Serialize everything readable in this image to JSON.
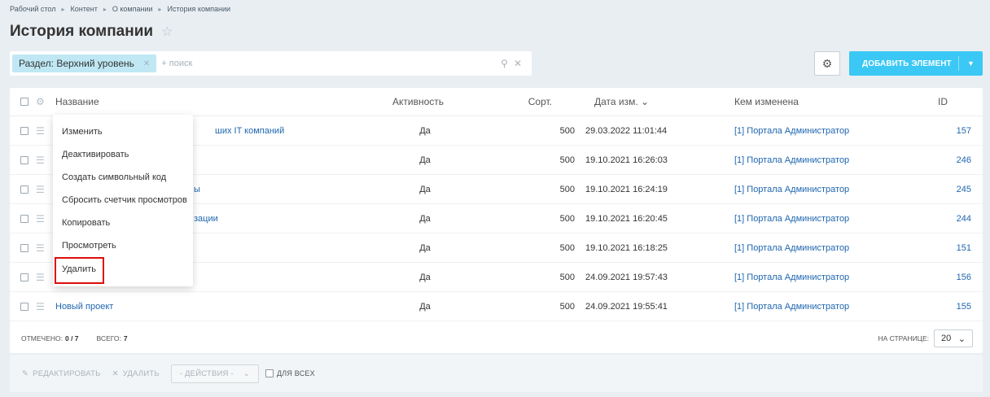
{
  "breadcrumb": [
    "Рабочий стол",
    "Контент",
    "О компании",
    "История компании"
  ],
  "page_title": "История компании",
  "filter": {
    "tag_label": "Раздел: Верхний уровень",
    "search_placeholder": "+ поиск"
  },
  "add_button_label": "ДОБАВИТЬ ЭЛЕМЕНТ",
  "columns": {
    "name": "Название",
    "active": "Активность",
    "sort": "Сорт.",
    "date": "Дата изм. ⌄",
    "changed_by": "Кем изменена",
    "id": "ID"
  },
  "rows": [
    {
      "name": "ших IT компаний",
      "active": "Да",
      "sort": "500",
      "date": "29.03.2022 11:01:44",
      "by": "[1] Портала Администратор",
      "id": "157"
    },
    {
      "name": "",
      "active": "Да",
      "sort": "500",
      "date": "19.10.2021 16:26:03",
      "by": "[1] Портала Администратор",
      "id": "246"
    },
    {
      "name": "ы",
      "active": "Да",
      "sort": "500",
      "date": "19.10.2021 16:24:19",
      "by": "[1] Портала Администратор",
      "id": "245"
    },
    {
      "name": "зации",
      "active": "Да",
      "sort": "500",
      "date": "19.10.2021 16:20:45",
      "by": "[1] Портала Администратор",
      "id": "244"
    },
    {
      "name": "",
      "active": "Да",
      "sort": "500",
      "date": "19.10.2021 16:18:25",
      "by": "[1] Портала Администратор",
      "id": "151"
    },
    {
      "name": "",
      "active": "Да",
      "sort": "500",
      "date": "24.09.2021 19:57:43",
      "by": "[1] Портала Администратор",
      "id": "156"
    },
    {
      "name": "Новый проект",
      "active": "Да",
      "sort": "500",
      "date": "24.09.2021 19:55:41",
      "by": "[1] Портала Администратор",
      "id": "155"
    }
  ],
  "footer": {
    "checked_label": "ОТМЕЧЕНО:",
    "checked_value": "0 / 7",
    "total_label": "ВСЕГО:",
    "total_value": "7",
    "per_page_label": "НА СТРАНИЦЕ:",
    "per_page_value": "20"
  },
  "actions": {
    "edit": "РЕДАКТИРОВАТЬ",
    "delete": "УДАЛИТЬ",
    "actions_select": "- ДЕЙСТВИЯ -",
    "for_all": "ДЛЯ ВСЕХ"
  },
  "context_menu": [
    "Изменить",
    "Деактивировать",
    "Создать символьный код",
    "Сбросить счетчик просмотров",
    "Копировать",
    "Просмотреть",
    "Удалить"
  ],
  "colors": {
    "accent": "#3bc8f5",
    "link": "#2067b0",
    "highlight": "#e00d0d"
  }
}
